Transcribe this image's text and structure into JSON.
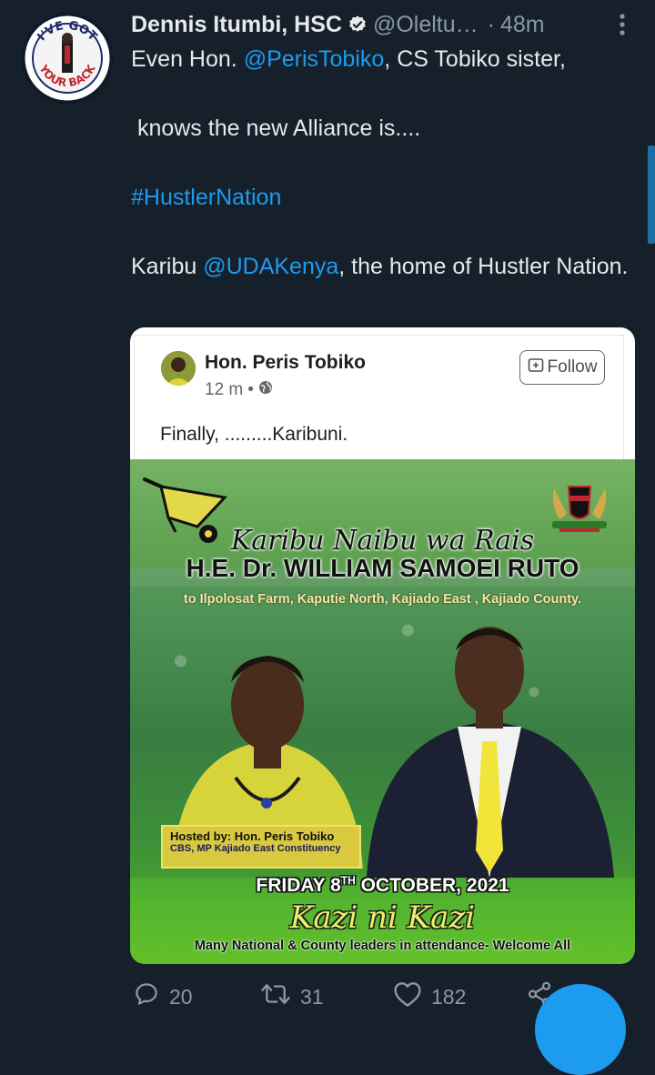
{
  "tweet": {
    "author_name": "Dennis Itumbi, HSC",
    "handle": "@Oleltu…",
    "separator": "·",
    "time": "48m",
    "line1_prefix": "Even Hon. ",
    "line1_mention": "@PerisTobiko",
    "line1_suffix": ", CS  Tobiko sister,",
    "line2": " knows the new Alliance is....",
    "hashtag": "#HustlerNation",
    "line4_prefix": "Karibu ",
    "line4_mention": "@UDAKenya",
    "line4_suffix": ", the home of Hustler Nation.",
    "link_color": "#1d9bf0"
  },
  "avatar": {
    "text_top": "I'VE GOT",
    "text_bottom": "YOUR BACK"
  },
  "embed": {
    "fb_name": "Hon. Peris Tobiko",
    "fb_time": "12 m",
    "fb_dot": "•",
    "follow_label": "Follow",
    "fb_text": "Finally, .........Karibuni.",
    "poster": {
      "karibu": "Karibu Naibu wa Rais",
      "he": "H.E. Dr. WILLIAM SAMOEI RUTO",
      "venue": "to Ilpolosat Farm, Kaputie North, Kajiado East , Kajiado County.",
      "hosted_prefix": "Hosted by: ",
      "hosted_name": "Hon. Peris Tobiko",
      "hosted_role": "CBS, MP Kajiado East Constituency",
      "friday_pre": "FRIDAY 8",
      "friday_sup": "TH",
      "friday_post": " OCTOBER, 2021",
      "kazi": "Kazi ni Kazi",
      "many": "Many National & County leaders in attendance- Welcome All"
    }
  },
  "actions": {
    "replies": "20",
    "retweets": "31",
    "likes": "182"
  }
}
